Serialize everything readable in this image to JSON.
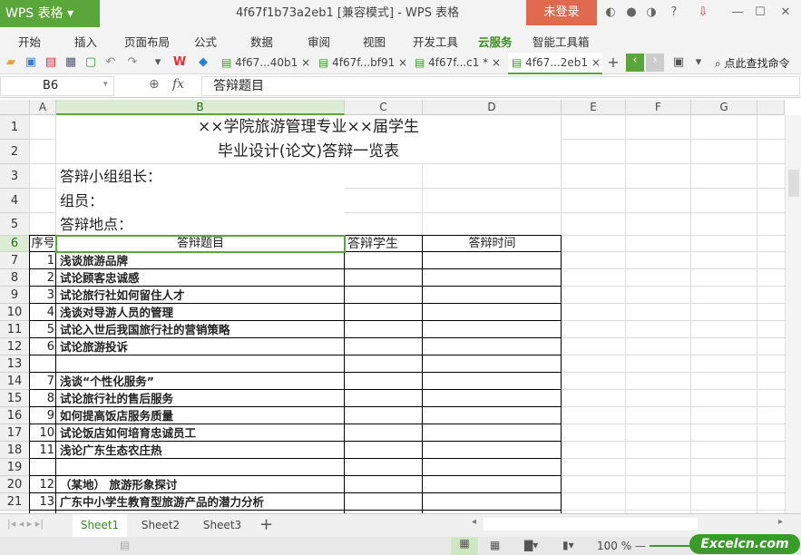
{
  "app": {
    "logo": "WPS 表格",
    "title": "4f67f1b73a2eb1 [兼容模式] - WPS 表格",
    "login": "未登录"
  },
  "menu": [
    "开始",
    "插入",
    "页面布局",
    "公式",
    "数据",
    "审阅",
    "视图",
    "开发工具",
    "云服务",
    "智能工具箱"
  ],
  "doc_tabs": [
    {
      "label": "4f67...40b1",
      "active": false
    },
    {
      "label": "4f67f...bf91",
      "active": false
    },
    {
      "label": "4f67f...c1 *",
      "active": false
    },
    {
      "label": "4f67...2eb1",
      "active": true
    }
  ],
  "search_label": "点此查找命令",
  "formula": {
    "cell_ref": "B6",
    "fx": "fx",
    "value": "答辩题目"
  },
  "columns": [
    "A",
    "B",
    "C",
    "D",
    "E",
    "F",
    "G"
  ],
  "selected_cell": "B6",
  "sheet": {
    "title1": "××学院旅游管理专业××届学生",
    "title2": "毕业设计(论文)答辩一览表",
    "leader": "答辩小组组长：",
    "members": "组员：",
    "location": "答辩地点：",
    "headers": [
      "序号",
      "答辩题目",
      "答辩学生",
      "答辩时间"
    ],
    "rows": [
      {
        "row": 7,
        "no": "1",
        "topic": "浅谈旅游品牌"
      },
      {
        "row": 8,
        "no": "2",
        "topic": "试论顾客忠诚感"
      },
      {
        "row": 9,
        "no": "3",
        "topic": "试论旅行社如何留住人才"
      },
      {
        "row": 10,
        "no": "4",
        "topic": "浅谈对导游人员的管理"
      },
      {
        "row": 11,
        "no": "5",
        "topic": "试论入世后我国旅行社的营销策略"
      },
      {
        "row": 12,
        "no": "6",
        "topic": "试论旅游投诉"
      },
      {
        "row": 13,
        "no": "",
        "topic": ""
      },
      {
        "row": 14,
        "no": "7",
        "topic": "浅谈“个性化服务”"
      },
      {
        "row": 15,
        "no": "8",
        "topic": "试论旅行社的售后服务"
      },
      {
        "row": 16,
        "no": "9",
        "topic": "如何提高饭店服务质量"
      },
      {
        "row": 17,
        "no": "10",
        "topic": "试论饭店如何培育忠诚员工"
      },
      {
        "row": 18,
        "no": "11",
        "topic": "浅论广东生态农庄热"
      },
      {
        "row": 19,
        "no": "",
        "topic": ""
      },
      {
        "row": 20,
        "no": "12",
        "topic": "（某地） 旅游形象探讨"
      },
      {
        "row": 21,
        "no": "13",
        "topic": "广东中小学生教育型旅游产品的潜力分析"
      }
    ]
  },
  "sheet_tabs": [
    {
      "label": "Sheet1",
      "active": true
    },
    {
      "label": "Sheet2",
      "active": false
    },
    {
      "label": "Sheet3",
      "active": false
    }
  ],
  "zoom": "100 %",
  "watermark": "Excelcn.com",
  "colors": {
    "accent": "#5aa63a",
    "login": "#e06a4f"
  }
}
